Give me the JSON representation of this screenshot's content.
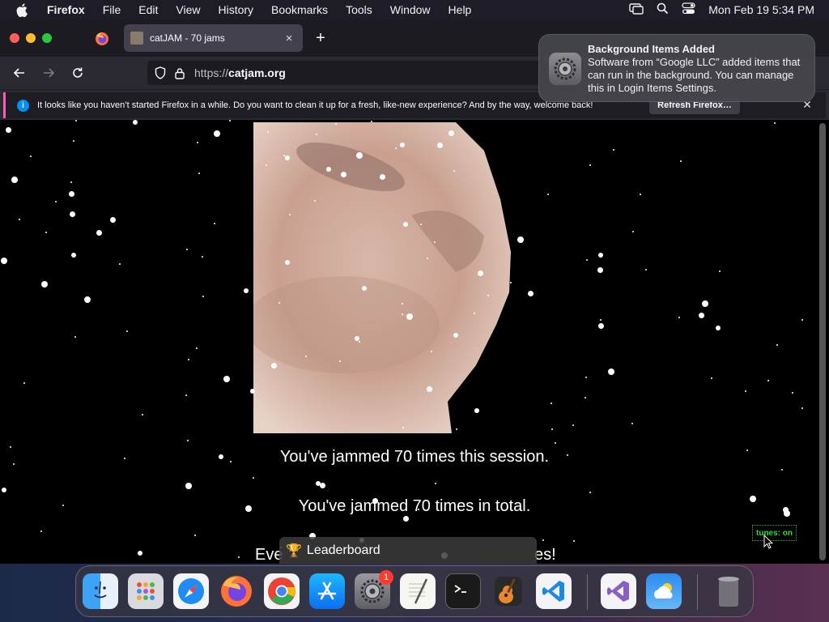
{
  "menubar": {
    "app_name": "Firefox",
    "items": [
      "File",
      "Edit",
      "View",
      "History",
      "Bookmarks",
      "Tools",
      "Window",
      "Help"
    ],
    "clock": "Mon Feb 19  5:34 PM"
  },
  "tabs": {
    "active_title": "catJAM - 70 jams",
    "close_glyph": "×",
    "new_tab_glyph": "+"
  },
  "urlbar": {
    "protocol": "https://",
    "host": "catjam.org"
  },
  "infobar": {
    "message": "It looks like you haven’t started Firefox in a while. Do you want to clean it up for a fresh, like-new experience? And by the way, welcome back!",
    "button": "Refresh Firefox…",
    "info_glyph": "i",
    "close_glyph": "✕"
  },
  "notification": {
    "title": "Background Items Added",
    "body": "Software from “Google LLC” added items that can run in the background. You can manage this in Login Items Settings."
  },
  "page": {
    "session_text": "You've jammed 70 times this session.",
    "total_text": "You've jammed 70 times in total.",
    "partial_left": "Eve",
    "partial_right": "es!",
    "leaderboard": "Leaderboard",
    "tunes": "tunes: on"
  },
  "dock": {
    "apps": [
      "Finder",
      "Launchpad",
      "Safari",
      "Firefox",
      "Chrome",
      "App Store",
      "System Settings",
      "TextEdit",
      "Terminal",
      "GarageBand",
      "Visual Studio Code",
      "Visual Studio",
      "Weather",
      "Trash"
    ],
    "settings_badge": "1"
  },
  "colors": {
    "menubar_bg": "#1e1c26",
    "tab_active_bg": "#42414d",
    "toolbar_bg": "#2b2a33",
    "infobar_accent": "#ff5cab",
    "tunes_green": "#33dd33"
  }
}
